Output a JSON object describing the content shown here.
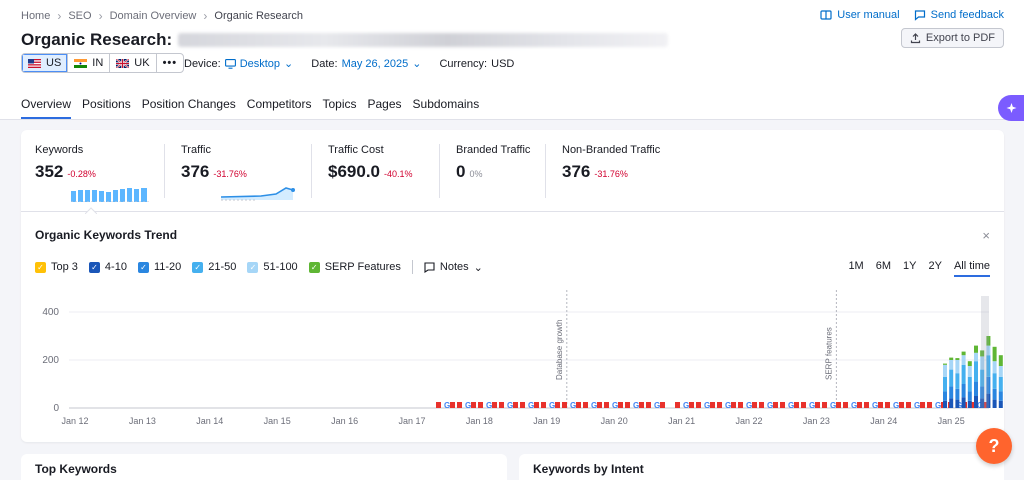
{
  "breadcrumb": [
    "Home",
    "SEO",
    "Domain Overview",
    "Organic Research"
  ],
  "header": {
    "title": "Organic Research:",
    "user_manual": "User manual",
    "send_feedback": "Send feedback",
    "export_label": "Export to PDF"
  },
  "countries": [
    {
      "code": "US",
      "active": true
    },
    {
      "code": "IN",
      "active": false
    },
    {
      "code": "UK",
      "active": false
    }
  ],
  "more_label": "•••",
  "filters": {
    "device_label": "Device:",
    "device_value": "Desktop",
    "date_label": "Date:",
    "date_value": "May 26, 2025",
    "currency_label": "Currency:",
    "currency_value": "USD"
  },
  "tabs": [
    "Overview",
    "Positions",
    "Position Changes",
    "Competitors",
    "Topics",
    "Pages",
    "Subdomains"
  ],
  "metrics": {
    "keywords": {
      "label": "Keywords",
      "value": "352",
      "delta": "-0.28%"
    },
    "traffic": {
      "label": "Traffic",
      "value": "376",
      "delta": "-31.76%"
    },
    "traffic_cost": {
      "label": "Traffic Cost",
      "value": "$690.0",
      "delta": "-40.1%"
    },
    "branded": {
      "label": "Branded Traffic",
      "value": "0",
      "delta": "0%"
    },
    "non_branded": {
      "label": "Non-Branded Traffic",
      "value": "376",
      "delta": "-31.76%"
    }
  },
  "trend": {
    "title": "Organic Keywords Trend",
    "close": "×",
    "legend": [
      {
        "label": "Top 3",
        "color": "#ffc107"
      },
      {
        "label": "4-10",
        "color": "#1a56b8"
      },
      {
        "label": "11-20",
        "color": "#2a86e0"
      },
      {
        "label": "21-50",
        "color": "#45b0ef"
      },
      {
        "label": "51-100",
        "color": "#a6d6f7"
      },
      {
        "label": "SERP Features",
        "color": "#5fb634"
      }
    ],
    "notes_label": "Notes",
    "ranges": [
      "1M",
      "6M",
      "1Y",
      "2Y",
      "All time"
    ],
    "active_range": "All time"
  },
  "chart_data": {
    "type": "bar",
    "stacked": true,
    "y_ticks": [
      0,
      200,
      400
    ],
    "ylim": [
      0,
      450
    ],
    "x_labels": [
      "Jan 12",
      "Jan 13",
      "Jan 14",
      "Jan 15",
      "Jan 16",
      "Jan 17",
      "Jan 18",
      "Jan 19",
      "Jan 20",
      "Jan 21",
      "Jan 22",
      "Jan 23",
      "Jan 24",
      "Jan 25"
    ],
    "annotations": [
      {
        "label": "Database growth",
        "x": "Jan 19"
      },
      {
        "label": "SERP features",
        "x": "Jan 23"
      }
    ],
    "series": [
      {
        "name": "4-10",
        "color": "#1a56b8",
        "values": [
          30,
          40,
          35,
          45,
          30,
          50,
          40,
          60,
          35,
          30
        ]
      },
      {
        "name": "11-20",
        "color": "#2a86e0",
        "values": [
          40,
          50,
          45,
          55,
          40,
          60,
          50,
          70,
          45,
          40
        ]
      },
      {
        "name": "21-50",
        "color": "#45b0ef",
        "values": [
          60,
          70,
          65,
          80,
          60,
          85,
          70,
          90,
          65,
          60
        ]
      },
      {
        "name": "51-100",
        "color": "#a6d6f7",
        "values": [
          50,
          40,
          55,
          40,
          45,
          35,
          55,
          40,
          50,
          45
        ]
      },
      {
        "name": "SERP Features",
        "color": "#5fb634",
        "values": [
          5,
          10,
          8,
          15,
          20,
          30,
          25,
          40,
          60,
          45
        ]
      }
    ],
    "grid": true
  },
  "bottom": {
    "top_keywords": "Top Keywords",
    "keywords_by_intent": "Keywords by Intent"
  },
  "help_label": "?"
}
